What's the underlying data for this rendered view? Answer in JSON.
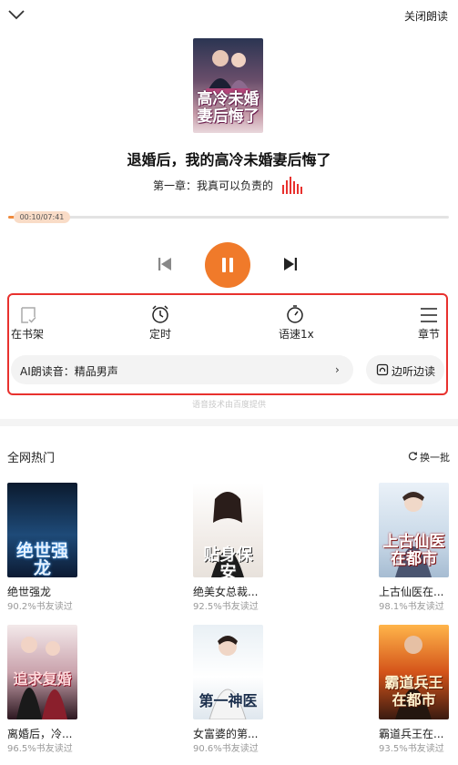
{
  "header": {
    "close_label": "关闭朗读"
  },
  "player": {
    "book_title": "退婚后，我的高冷未婚妻后悔了",
    "chapter": "第一章：我真可以负责的",
    "time": "00:10/07:41",
    "progress_fraction": 0.022,
    "cover_title": "高冷未婚妻后悔了",
    "accent_color": "#f07a2a"
  },
  "tools": {
    "shelf": "在书架",
    "timer": "定时",
    "speed": "语速1x",
    "chapters": "章节",
    "voice": "AI朗读音：精品男声",
    "voice_arrow": "›",
    "listen": "边听边读",
    "credit": "语音技术由百度提供"
  },
  "hot": {
    "title": "全网热门",
    "refresh": "换一批",
    "books": [
      {
        "name": "绝世强龙",
        "rate": "90.2%书友读过",
        "cover_text": "绝世强龙"
      },
      {
        "name": "绝美女总裁...",
        "rate": "92.5%书友读过",
        "cover_text": "贴身保安"
      },
      {
        "name": "上古仙医在...",
        "rate": "98.1%书友读过",
        "cover_text": "上古仙医在都市"
      },
      {
        "name": "离婚后，冷...",
        "rate": "96.5%书友读过",
        "cover_text": "追求复婚"
      },
      {
        "name": "女富婆的第...",
        "rate": "90.6%书友读过",
        "cover_text": "第一神医"
      },
      {
        "name": "霸道兵王在...",
        "rate": "93.5%书友读过",
        "cover_text": "霸道兵王在都市"
      }
    ]
  }
}
